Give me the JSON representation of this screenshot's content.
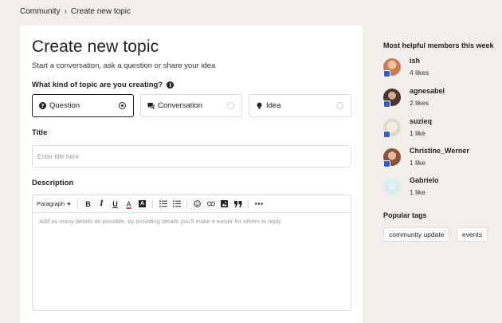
{
  "breadcrumb": {
    "root": "Community",
    "separator": "›",
    "current": "Create new topic"
  },
  "form": {
    "title": "Create new topic",
    "subtitle": "Start a conversation, ask a question or share your idea",
    "kind_label": "What kind of topic are you creating?",
    "info_icon": "i",
    "kinds": [
      {
        "label": "Question",
        "icon": "question-icon",
        "selected": true
      },
      {
        "label": "Conversation",
        "icon": "chat-icon",
        "selected": false
      },
      {
        "label": "Idea",
        "icon": "lightbulb-icon",
        "selected": false
      }
    ],
    "title_label": "Title",
    "title_placeholder": "Enter title here",
    "title_value": "",
    "description_label": "Description",
    "description_placeholder": "Add as many details as possible, by providing details you'll make it easier for others to reply",
    "toolbar": {
      "paragraph": "Paragraph",
      "bold": "B",
      "italic": "I",
      "underline": "U",
      "text_color": "A",
      "highlight": "A"
    }
  },
  "sidebar": {
    "helpful_heading": "Most helpful members this week",
    "members": [
      {
        "name": "ish",
        "likes": "4 likes",
        "avatar_color": "#c97b54",
        "badge": true
      },
      {
        "name": "agnesabel",
        "likes": "2 likes",
        "avatar_color": "#6a4a3c",
        "badge": true
      },
      {
        "name": "suzieq",
        "likes": "1 like",
        "avatar_color": "#e8e0d2",
        "badge": true
      },
      {
        "name": "Christine_Werner",
        "likes": "1 like",
        "avatar_color": "#9b5a43",
        "badge": true
      },
      {
        "name": "Gabrielo",
        "likes": "1 like",
        "avatar_color": "#d8eef2",
        "initial": "G",
        "badge": false
      }
    ],
    "tags_heading": "Popular tags",
    "tags": [
      "community update",
      "events"
    ]
  },
  "colors": {
    "badge": "#2f5fc6",
    "background": "#f2efea",
    "card": "#ffffff"
  }
}
